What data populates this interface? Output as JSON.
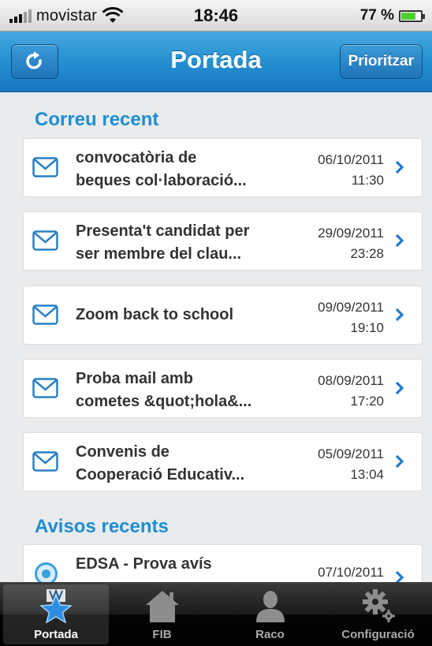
{
  "status_bar": {
    "carrier": "movistar",
    "time": "18:46",
    "battery": "77 %",
    "battery_level": 0.77
  },
  "nav_bar": {
    "title": "Portada",
    "refresh_icon": "refresh-icon",
    "prioritize_label": "Prioritzar"
  },
  "mail_section": {
    "title": "Correu recent",
    "items": [
      {
        "subject": "convocatòria de beques col·laboració...",
        "line1": "convocatòria de",
        "line2": "beques col·laboració...",
        "date": "06/10/2011",
        "time": "11:30"
      },
      {
        "subject": "Presenta't candidat per ser membre del clau...",
        "line1": "Presenta't candidat per",
        "line2": "ser membre del clau...",
        "date": "29/09/2011",
        "time": "23:28"
      },
      {
        "subject": "Zoom back to school",
        "line1": "Zoom back to school",
        "line2": "",
        "date": "09/09/2011",
        "time": "19:10"
      },
      {
        "subject": "Proba mail amb cometes &quot;hola&...",
        "line1": "Proba mail amb",
        "line2": "cometes &quot;hola&...",
        "date": "08/09/2011",
        "time": "17:20"
      },
      {
        "subject": "Convenis de Cooperació Educativ...",
        "line1": "Convenis de",
        "line2": "Cooperació Educativ...",
        "date": "05/09/2011",
        "time": "13:04"
      }
    ]
  },
  "notices_section": {
    "title": "Avisos recents",
    "items": [
      {
        "line1": "EDSA - Prova avís",
        "date": "07/10/2011"
      }
    ]
  },
  "tab_bar": {
    "tabs": [
      {
        "label": "Portada",
        "icon": "star-icon",
        "active": true
      },
      {
        "label": "FIB",
        "icon": "house-icon",
        "active": false
      },
      {
        "label": "Raco",
        "icon": "person-icon",
        "active": false
      },
      {
        "label": "Configuració",
        "icon": "gear-icon",
        "active": false
      }
    ]
  },
  "colors": {
    "accent": "#1e8ed0",
    "nav_blue": "#2490d2",
    "icon_blue": "#2a7fc4"
  }
}
